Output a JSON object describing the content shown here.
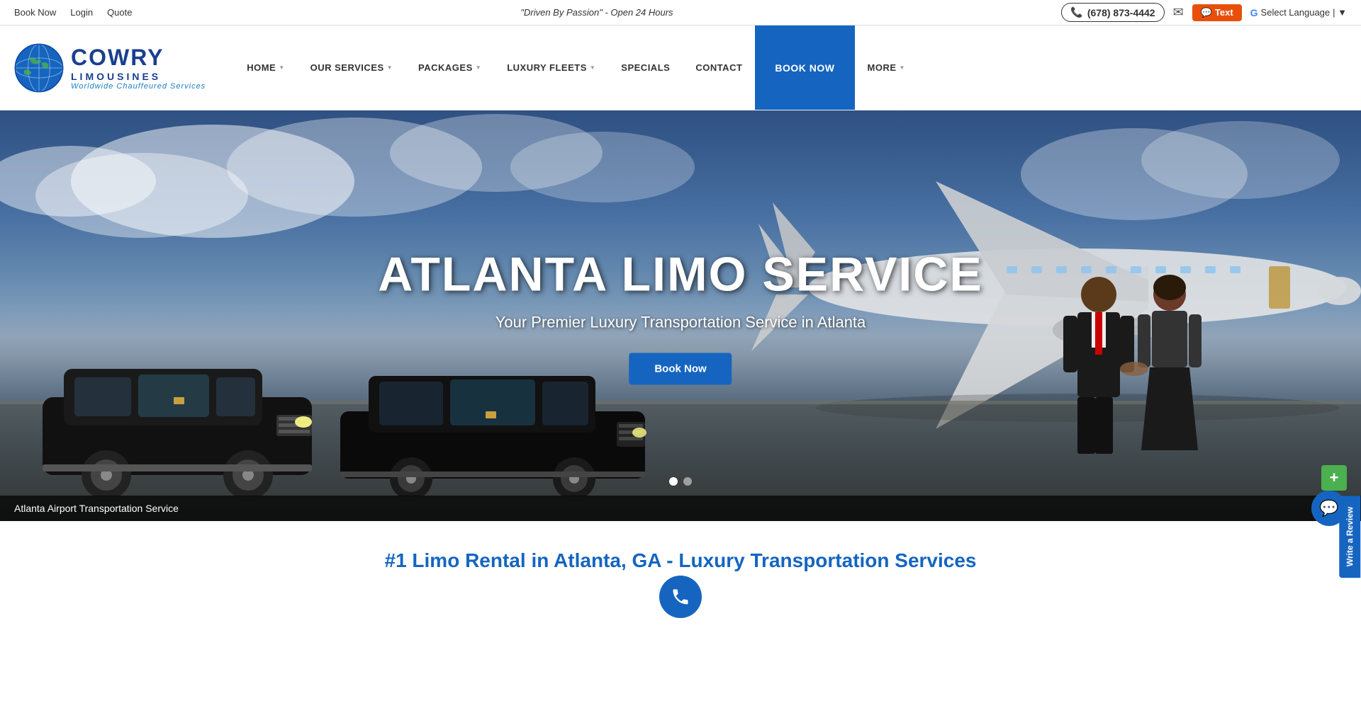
{
  "utility_bar": {
    "links": [
      {
        "label": "Book Now",
        "id": "book-now-link"
      },
      {
        "label": "Login",
        "id": "login-link"
      },
      {
        "label": "Quote",
        "id": "quote-link"
      }
    ],
    "tagline": "\"Driven By Passion\" - Open 24 Hours",
    "phone": "(678) 873-4442",
    "text_btn": "Text",
    "translate_label": "Select Language",
    "translate_separator": "▼"
  },
  "navbar": {
    "logo": {
      "cowry": "COWRY",
      "star": "★",
      "limousines": "LIMOUSINES",
      "subtitle": "Worldwide Chauffeured Services"
    },
    "nav_items": [
      {
        "label": "HOME",
        "has_dropdown": true
      },
      {
        "label": "OUR SERVICES",
        "has_dropdown": true
      },
      {
        "label": "PACKAGES",
        "has_dropdown": true
      },
      {
        "label": "LUXURY FLEETS",
        "has_dropdown": true
      },
      {
        "label": "SPECIALS",
        "has_dropdown": false
      },
      {
        "label": "CONTACT",
        "has_dropdown": false
      },
      {
        "label": "BOOK NOW",
        "has_dropdown": false,
        "is_cta": true
      },
      {
        "label": "MORE",
        "has_dropdown": true
      }
    ]
  },
  "hero": {
    "title": "ATLANTA LIMO SERVICE",
    "subtitle": "Your Premier Luxury Transportation Service in Atlanta",
    "cta_button": "Book Now",
    "caption": "Atlanta Airport Transportation Service",
    "slide_dots": [
      {
        "active": true
      },
      {
        "active": false
      }
    ]
  },
  "bottom": {
    "title": "#1 Limo Rental in Atlanta, GA - Luxury Transportation Services"
  },
  "floating": {
    "plus_icon": "+",
    "chat_icon": "💬",
    "write_review": "Write a Review"
  }
}
